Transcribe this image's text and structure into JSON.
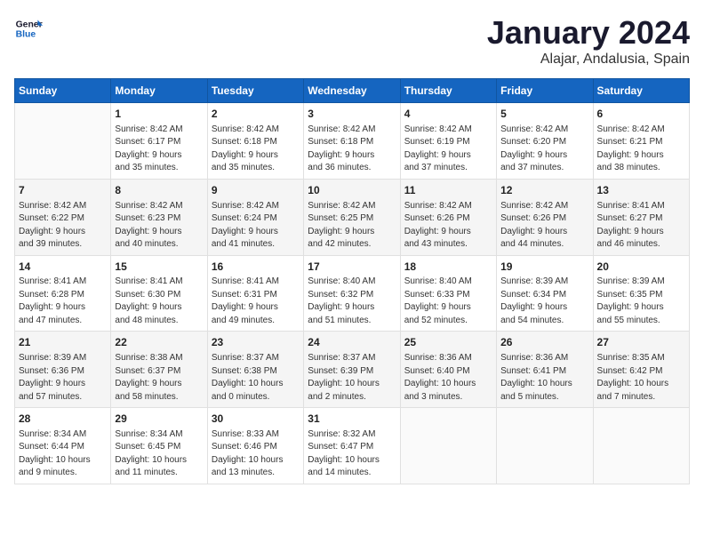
{
  "header": {
    "logo_general": "General",
    "logo_blue": "Blue",
    "month": "January 2024",
    "location": "Alajar, Andalusia, Spain"
  },
  "weekdays": [
    "Sunday",
    "Monday",
    "Tuesday",
    "Wednesday",
    "Thursday",
    "Friday",
    "Saturday"
  ],
  "weeks": [
    [
      {
        "day": "",
        "content": ""
      },
      {
        "day": "1",
        "content": "Sunrise: 8:42 AM\nSunset: 6:17 PM\nDaylight: 9 hours\nand 35 minutes."
      },
      {
        "day": "2",
        "content": "Sunrise: 8:42 AM\nSunset: 6:18 PM\nDaylight: 9 hours\nand 35 minutes."
      },
      {
        "day": "3",
        "content": "Sunrise: 8:42 AM\nSunset: 6:18 PM\nDaylight: 9 hours\nand 36 minutes."
      },
      {
        "day": "4",
        "content": "Sunrise: 8:42 AM\nSunset: 6:19 PM\nDaylight: 9 hours\nand 37 minutes."
      },
      {
        "day": "5",
        "content": "Sunrise: 8:42 AM\nSunset: 6:20 PM\nDaylight: 9 hours\nand 37 minutes."
      },
      {
        "day": "6",
        "content": "Sunrise: 8:42 AM\nSunset: 6:21 PM\nDaylight: 9 hours\nand 38 minutes."
      }
    ],
    [
      {
        "day": "7",
        "content": "Sunrise: 8:42 AM\nSunset: 6:22 PM\nDaylight: 9 hours\nand 39 minutes."
      },
      {
        "day": "8",
        "content": "Sunrise: 8:42 AM\nSunset: 6:23 PM\nDaylight: 9 hours\nand 40 minutes."
      },
      {
        "day": "9",
        "content": "Sunrise: 8:42 AM\nSunset: 6:24 PM\nDaylight: 9 hours\nand 41 minutes."
      },
      {
        "day": "10",
        "content": "Sunrise: 8:42 AM\nSunset: 6:25 PM\nDaylight: 9 hours\nand 42 minutes."
      },
      {
        "day": "11",
        "content": "Sunrise: 8:42 AM\nSunset: 6:26 PM\nDaylight: 9 hours\nand 43 minutes."
      },
      {
        "day": "12",
        "content": "Sunrise: 8:42 AM\nSunset: 6:26 PM\nDaylight: 9 hours\nand 44 minutes."
      },
      {
        "day": "13",
        "content": "Sunrise: 8:41 AM\nSunset: 6:27 PM\nDaylight: 9 hours\nand 46 minutes."
      }
    ],
    [
      {
        "day": "14",
        "content": "Sunrise: 8:41 AM\nSunset: 6:28 PM\nDaylight: 9 hours\nand 47 minutes."
      },
      {
        "day": "15",
        "content": "Sunrise: 8:41 AM\nSunset: 6:30 PM\nDaylight: 9 hours\nand 48 minutes."
      },
      {
        "day": "16",
        "content": "Sunrise: 8:41 AM\nSunset: 6:31 PM\nDaylight: 9 hours\nand 49 minutes."
      },
      {
        "day": "17",
        "content": "Sunrise: 8:40 AM\nSunset: 6:32 PM\nDaylight: 9 hours\nand 51 minutes."
      },
      {
        "day": "18",
        "content": "Sunrise: 8:40 AM\nSunset: 6:33 PM\nDaylight: 9 hours\nand 52 minutes."
      },
      {
        "day": "19",
        "content": "Sunrise: 8:39 AM\nSunset: 6:34 PM\nDaylight: 9 hours\nand 54 minutes."
      },
      {
        "day": "20",
        "content": "Sunrise: 8:39 AM\nSunset: 6:35 PM\nDaylight: 9 hours\nand 55 minutes."
      }
    ],
    [
      {
        "day": "21",
        "content": "Sunrise: 8:39 AM\nSunset: 6:36 PM\nDaylight: 9 hours\nand 57 minutes."
      },
      {
        "day": "22",
        "content": "Sunrise: 8:38 AM\nSunset: 6:37 PM\nDaylight: 9 hours\nand 58 minutes."
      },
      {
        "day": "23",
        "content": "Sunrise: 8:37 AM\nSunset: 6:38 PM\nDaylight: 10 hours\nand 0 minutes."
      },
      {
        "day": "24",
        "content": "Sunrise: 8:37 AM\nSunset: 6:39 PM\nDaylight: 10 hours\nand 2 minutes."
      },
      {
        "day": "25",
        "content": "Sunrise: 8:36 AM\nSunset: 6:40 PM\nDaylight: 10 hours\nand 3 minutes."
      },
      {
        "day": "26",
        "content": "Sunrise: 8:36 AM\nSunset: 6:41 PM\nDaylight: 10 hours\nand 5 minutes."
      },
      {
        "day": "27",
        "content": "Sunrise: 8:35 AM\nSunset: 6:42 PM\nDaylight: 10 hours\nand 7 minutes."
      }
    ],
    [
      {
        "day": "28",
        "content": "Sunrise: 8:34 AM\nSunset: 6:44 PM\nDaylight: 10 hours\nand 9 minutes."
      },
      {
        "day": "29",
        "content": "Sunrise: 8:34 AM\nSunset: 6:45 PM\nDaylight: 10 hours\nand 11 minutes."
      },
      {
        "day": "30",
        "content": "Sunrise: 8:33 AM\nSunset: 6:46 PM\nDaylight: 10 hours\nand 13 minutes."
      },
      {
        "day": "31",
        "content": "Sunrise: 8:32 AM\nSunset: 6:47 PM\nDaylight: 10 hours\nand 14 minutes."
      },
      {
        "day": "",
        "content": ""
      },
      {
        "day": "",
        "content": ""
      },
      {
        "day": "",
        "content": ""
      }
    ]
  ]
}
